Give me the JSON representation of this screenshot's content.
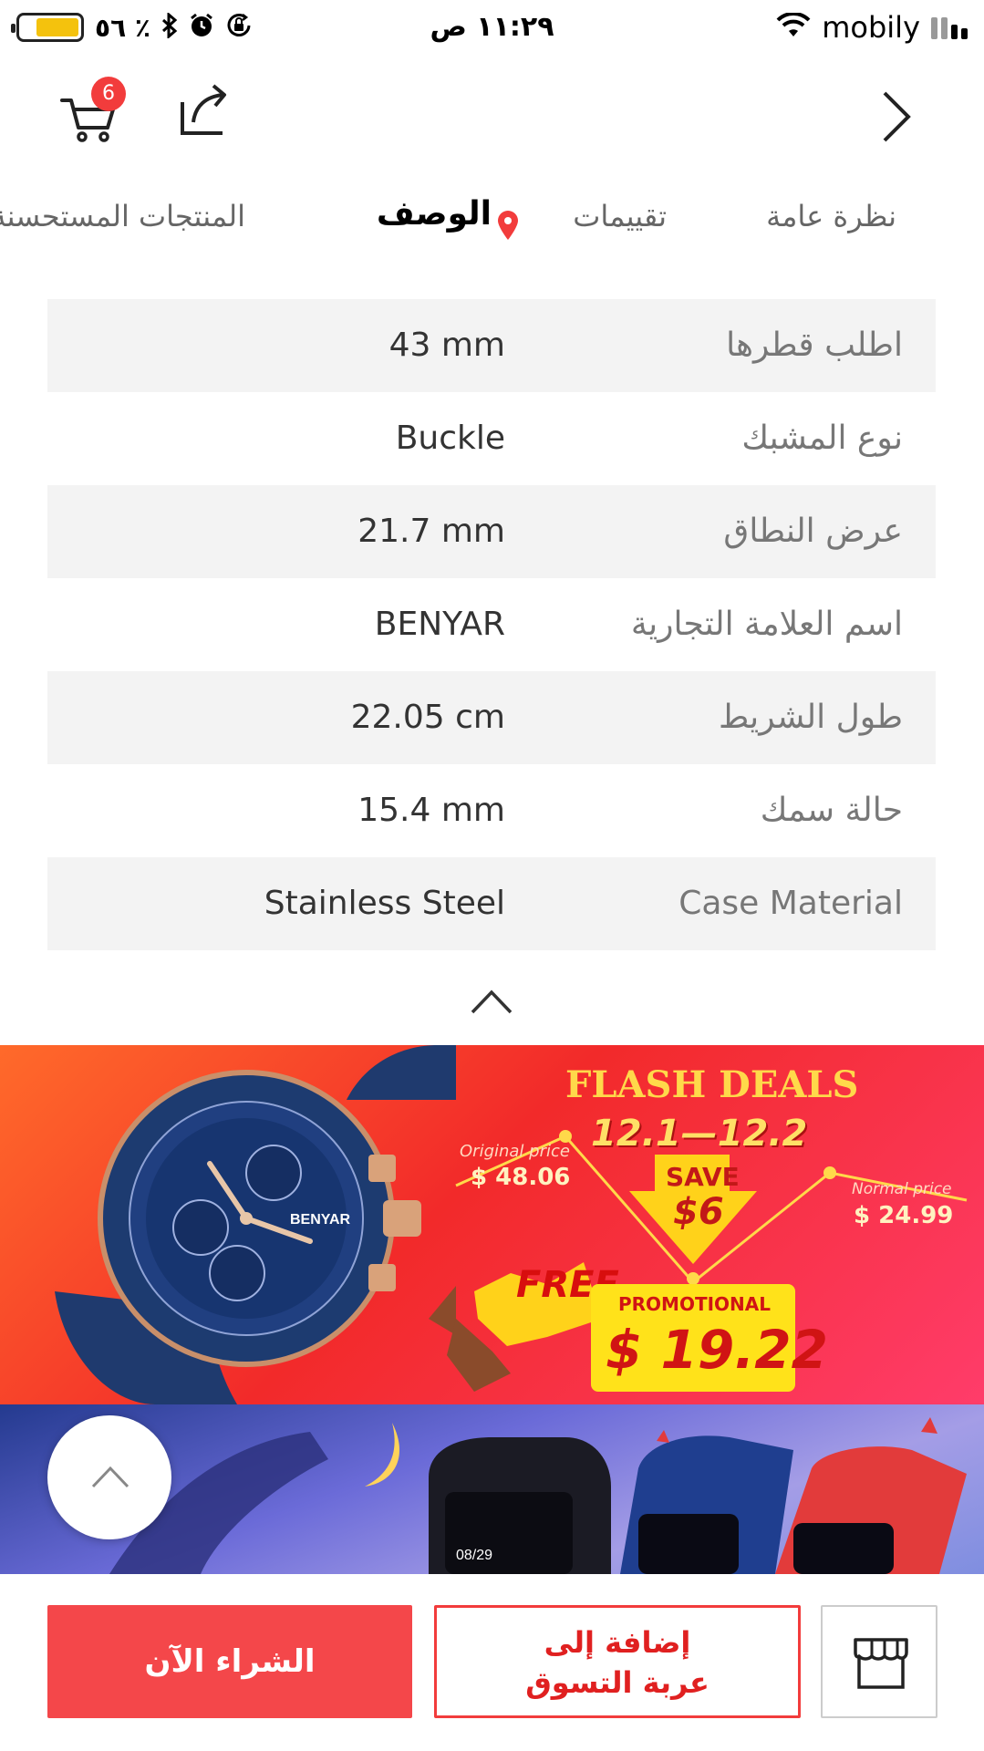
{
  "status_bar": {
    "battery_percent": "٥٦ ٪",
    "time": "١١:٢٩ ص",
    "carrier": "mobily",
    "battery_level": 0.74
  },
  "header": {
    "cart_count": "6"
  },
  "tabs": {
    "overview": "نظرة عامة",
    "reviews": "تقييمات",
    "description": "الوصف",
    "recommended": "المنتجات المستحسنة"
  },
  "specs": [
    {
      "label": "اطلب قطرها",
      "value": "43 mm"
    },
    {
      "label": "نوع المشبك",
      "value": "Buckle"
    },
    {
      "label": "عرض النطاق",
      "value": "21.7 mm"
    },
    {
      "label": "اسم العلامة التجارية",
      "value": "BENYAR"
    },
    {
      "label": "طول الشريط",
      "value": "22.05 cm"
    },
    {
      "label": "حالة سمك",
      "value": "15.4 mm"
    },
    {
      "label": "Case Material",
      "value": "Stainless Steel"
    }
  ],
  "banner": {
    "title": "FLASH DEALS",
    "dates": "12.1—12.2",
    "original_label": "Original price",
    "original_price": "$ 48.06",
    "normal_label": "Normal price",
    "normal_price": "$ 24.99",
    "save_label": "SAVE",
    "save_amount": "$6",
    "free_label": "FREE",
    "promo_label": "PROMOTIONAL",
    "promo_price": "$ 19.22",
    "watch_brand": "BENYAR",
    "band_date": "08/29"
  },
  "bottom_bar": {
    "buy_now": "الشراء الآن",
    "add_to_cart_line1": "إضافة إلى",
    "add_to_cart_line2": "عربة التسوق"
  },
  "colors": {
    "accent_red": "#f4474a",
    "badge_red": "#f23c3c",
    "shaded_row": "#f3f3f3"
  },
  "icons": [
    "cart-icon",
    "share-icon",
    "chevron-right-icon",
    "location-pin-icon",
    "chevron-up-icon",
    "store-icon",
    "bluetooth-icon",
    "alarm-icon",
    "rotation-lock-icon",
    "wifi-icon",
    "signal-icon"
  ]
}
